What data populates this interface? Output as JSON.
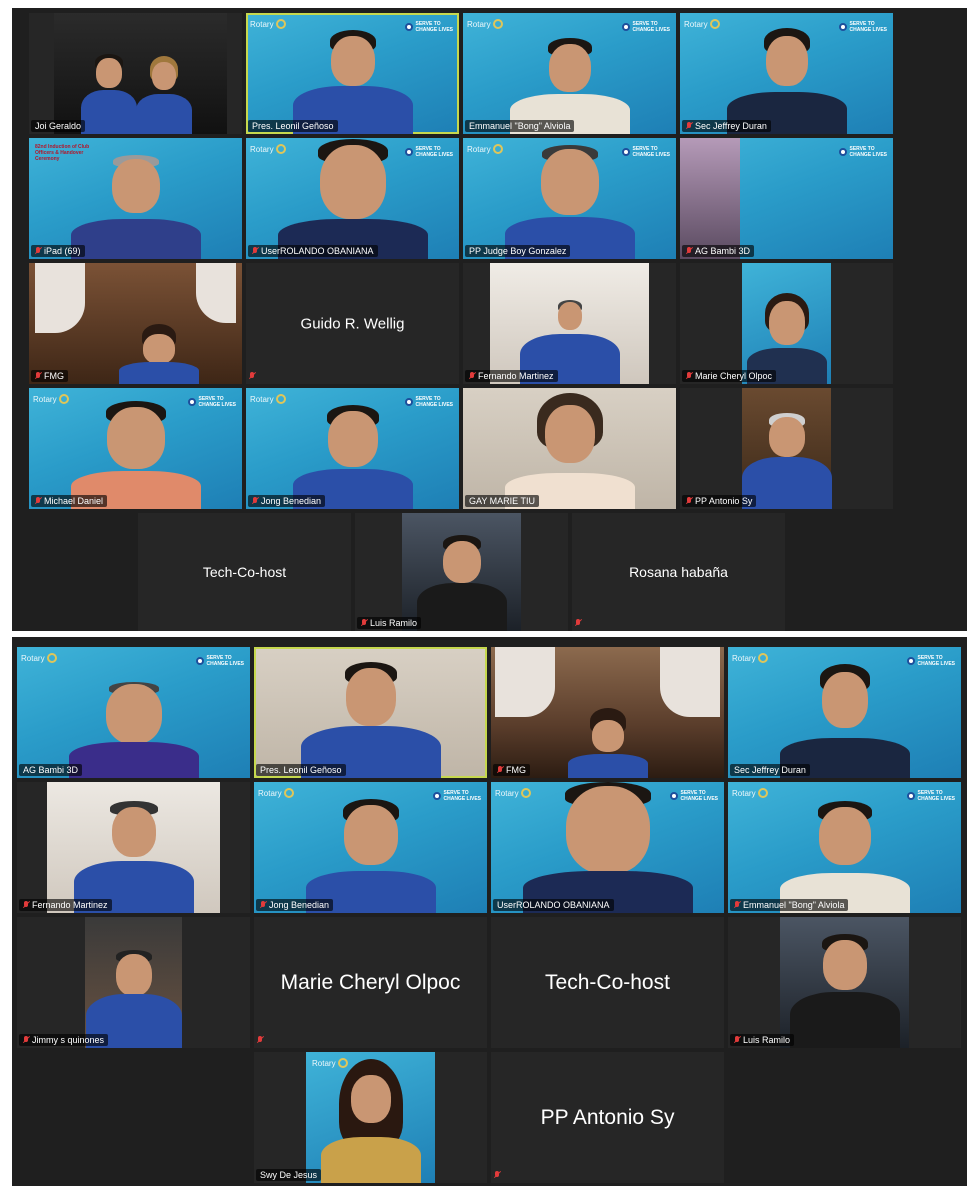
{
  "meeting_top": {
    "tiles": [
      {
        "name": "Joi Geraldo",
        "muted": false,
        "kind": "photo-night"
      },
      {
        "name": "Pres. Leonil Geñoso",
        "muted": false,
        "kind": "rotary",
        "active": true
      },
      {
        "name": "Emmanuel \"Bong\" Alviola",
        "muted": false,
        "kind": "rotary"
      },
      {
        "name": "Sec Jeffrey Duran",
        "muted": true,
        "kind": "rotary"
      },
      {
        "name": "iPad (69)",
        "muted": true,
        "kind": "rotary",
        "banner": "82nd Induction of Club Officers & Handover Ceremony"
      },
      {
        "name": "UserROLANDO OBANIANA",
        "muted": true,
        "kind": "rotary"
      },
      {
        "name": "PP Judge Boy Gonzalez",
        "muted": false,
        "kind": "rotary"
      },
      {
        "name": "AG Bambi 3D",
        "muted": true,
        "kind": "rotary"
      },
      {
        "name": "FMG",
        "muted": true,
        "kind": "photo-room"
      },
      {
        "name": "Guido R. Wellig",
        "muted": true,
        "kind": "dark"
      },
      {
        "name": "Fernando Martinez",
        "muted": true,
        "kind": "photo-wall"
      },
      {
        "name": "Marie Cheryl Olpoc",
        "muted": true,
        "kind": "rotary"
      },
      {
        "name": "Michael Daniel",
        "muted": true,
        "kind": "rotary"
      },
      {
        "name": "Jong Benedian",
        "muted": true,
        "kind": "rotary"
      },
      {
        "name": "GAY MARIE TIU",
        "muted": false,
        "kind": "photo-wall"
      },
      {
        "name": "PP Antonio Sy",
        "muted": true,
        "kind": "photo-night"
      },
      {
        "name": "Tech-Co-host",
        "muted": false,
        "kind": "dark"
      },
      {
        "name": "Luis Ramilo",
        "muted": true,
        "kind": "photo-car"
      },
      {
        "name": "Rosana habaña",
        "muted": true,
        "kind": "dark"
      }
    ]
  },
  "meeting_bottom": {
    "tiles": [
      {
        "name": "AG Bambi 3D",
        "muted": false,
        "kind": "rotary"
      },
      {
        "name": "Pres. Leonil Geñoso",
        "muted": false,
        "kind": "photo-wall",
        "active": true
      },
      {
        "name": "FMG",
        "muted": true,
        "kind": "photo-room"
      },
      {
        "name": "Sec Jeffrey Duran",
        "muted": false,
        "kind": "rotary"
      },
      {
        "name": "Fernando Martinez",
        "muted": true,
        "kind": "photo-wall"
      },
      {
        "name": "Jong Benedian",
        "muted": true,
        "kind": "rotary"
      },
      {
        "name": "UserROLANDO OBANIANA",
        "muted": false,
        "kind": "rotary"
      },
      {
        "name": "Emmanuel \"Bong\" Alviola",
        "muted": true,
        "kind": "rotary"
      },
      {
        "name": "Jimmy s quinones",
        "muted": true,
        "kind": "photo-night"
      },
      {
        "name": "Marie Cheryl Olpoc",
        "muted": true,
        "kind": "dark"
      },
      {
        "name": "Tech-Co-host",
        "muted": false,
        "kind": "dark"
      },
      {
        "name": "Luis Ramilo",
        "muted": true,
        "kind": "photo-car"
      },
      {
        "name": "Swy De Jesus",
        "muted": false,
        "kind": "rotary"
      },
      {
        "name": "PP Antonio Sy",
        "muted": true,
        "kind": "dark"
      }
    ]
  },
  "branding": {
    "club": "Rotary",
    "club_sub": "Club",
    "serve_line1": "SERVE TO",
    "serve_line2": "CHANGE LIVES"
  },
  "colors": {
    "panel_bg": "#1f1f1f",
    "tile_dark": "#262626",
    "active_border": "#c6d84e",
    "muted_red": "#e23b3b",
    "rotary_blue": "#2a9cc9"
  }
}
